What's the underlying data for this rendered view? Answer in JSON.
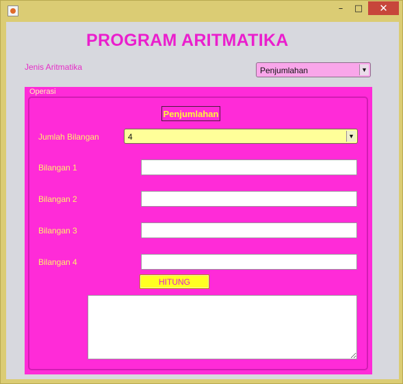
{
  "window": {
    "min_glyph": "–",
    "max_glyph": "□",
    "close_glyph": "✕"
  },
  "app": {
    "title": "PROGRAM ARITMATIKA"
  },
  "jenis": {
    "label": "Jenis Aritmatika",
    "selected": "Penjumlahan"
  },
  "operasi": {
    "title": "Operasi",
    "operation_label": "Penjumlahan",
    "jumlah_label": "Jumlah Bilangan",
    "jumlah_selected": "4",
    "bilangan": [
      {
        "label": "Bilangan 1",
        "value": ""
      },
      {
        "label": "Bilangan 2",
        "value": ""
      },
      {
        "label": "Bilangan 3",
        "value": ""
      },
      {
        "label": "Bilangan 4",
        "value": ""
      }
    ],
    "hitung_label": "HITUNG",
    "result": ""
  },
  "colors": {
    "title": "#ea1fcd",
    "panel": "#ff2bd8",
    "label": "#fff26a",
    "button": "#ffff22",
    "jenis_combo": "#f9a6ea",
    "jumlah_combo": "#ffff99",
    "close_button": "#c7463b"
  },
  "icons": {
    "app": "java-app-icon",
    "minimize": "minimize-icon",
    "maximize": "maximize-icon",
    "close": "close-icon",
    "dropdown": "chevron-down-icon"
  }
}
